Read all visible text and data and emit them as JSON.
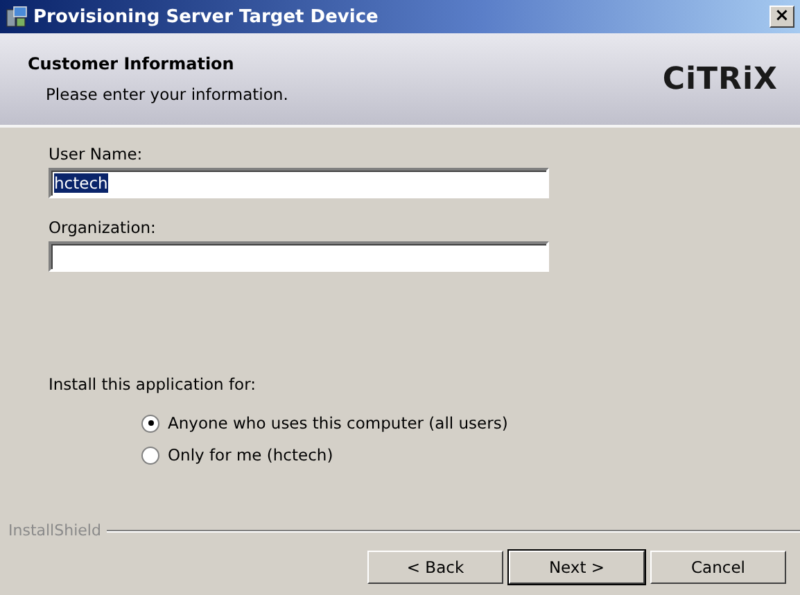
{
  "window": {
    "title": "Provisioning Server Target Device",
    "close": "×"
  },
  "header": {
    "title": "Customer Information",
    "subtitle": "Please enter your information.",
    "logo": "CiTRiX"
  },
  "fields": [
    {
      "label": "User Name:",
      "value": "hctech",
      "highlighted": true
    },
    {
      "label": "Organization:"
    }
  ],
  "install_for": {
    "label": "Install this application for:",
    "options": [
      {
        "label": "Anyone who uses this computer (all users)",
        "selected": true
      },
      {
        "label": "Only for me (hctech)",
        "selected": false
      }
    ]
  },
  "footer": {
    "brand": "InstallShield"
  },
  "buttons": [
    {
      "label": "< Back",
      "default": false
    },
    {
      "label": "Next >",
      "default": true
    },
    {
      "label": "Cancel",
      "default": false
    }
  ]
}
